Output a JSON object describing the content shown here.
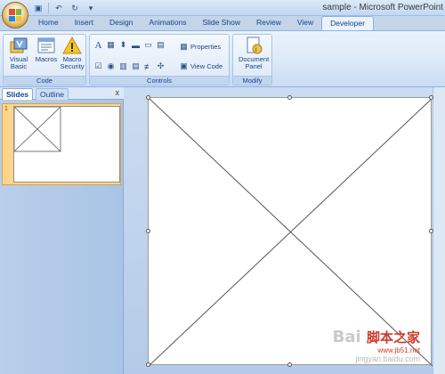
{
  "window": {
    "title": "sample - Microsoft PowerPoint"
  },
  "quick_access": [
    {
      "name": "save-icon",
      "glyph": "▣"
    },
    {
      "name": "undo-icon",
      "glyph": "↶"
    },
    {
      "name": "redo-icon",
      "glyph": "↻"
    },
    {
      "name": "customize-qat-icon",
      "glyph": "▾"
    }
  ],
  "tabs": [
    "Home",
    "Insert",
    "Design",
    "Animations",
    "Slide Show",
    "Review",
    "View",
    "Developer"
  ],
  "active_tab": "Developer",
  "ribbon": {
    "code_group": {
      "label": "Code",
      "visual_basic": "Visual Basic",
      "macros": "Macros",
      "macro_security": "Macro Security"
    },
    "controls_group": {
      "label": "Controls",
      "properties": "Properties",
      "view_code": "View Code"
    },
    "modify_group": {
      "label": "Modify",
      "document_panel": "Document Panel"
    }
  },
  "slides_pane": {
    "tab_slides": "Slides",
    "tab_outline": "Outline",
    "close": "x",
    "thumbnail_number": "1"
  },
  "watermark": {
    "logo": "Bai",
    "site_cn": "脚本之家",
    "url": "www.jb51.net",
    "url2": "jingyan.baidu.com"
  }
}
